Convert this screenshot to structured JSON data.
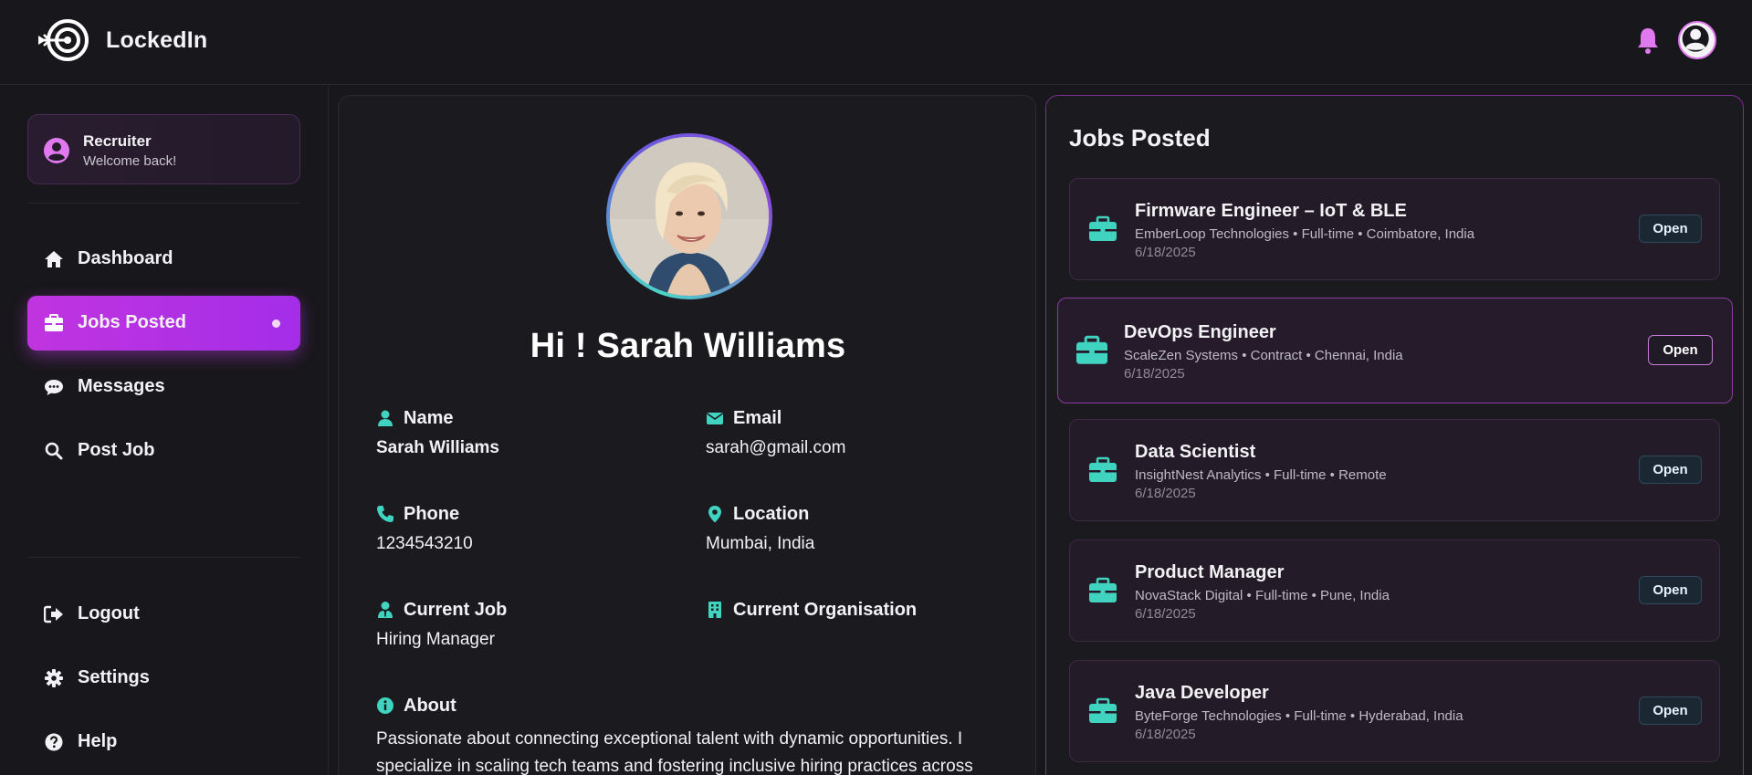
{
  "header": {
    "app_name": "LockedIn",
    "bell_icon": "bell-icon",
    "avatar_icon": "user-circle-icon",
    "accent": "#e079f0"
  },
  "sidebar": {
    "role": {
      "title": "Recruiter",
      "subtitle": "Welcome back!"
    },
    "nav": [
      {
        "label": "Dashboard",
        "icon": "home-icon",
        "active": false
      },
      {
        "label": "Jobs Posted",
        "icon": "briefcase-icon",
        "active": true
      },
      {
        "label": "Messages",
        "icon": "chat-icon",
        "active": false
      },
      {
        "label": "Post Job",
        "icon": "search-icon",
        "active": false
      }
    ],
    "bottom": [
      {
        "label": "Logout",
        "icon": "logout-icon"
      },
      {
        "label": "Settings",
        "icon": "gear-icon"
      },
      {
        "label": "Help",
        "icon": "help-icon"
      }
    ],
    "active_color": "#c134e0"
  },
  "profile": {
    "greeting": "Hi ! Sarah Williams",
    "fields": {
      "name_label": "Name",
      "name_value": "Sarah Williams",
      "email_label": "Email",
      "email_value": "sarah@gmail.com",
      "phone_label": "Phone",
      "phone_value": "1234543210",
      "location_label": "Location",
      "location_value": "Mumbai, India",
      "job_label": "Current Job",
      "job_value": "Hiring Manager",
      "org_label": "Current Organisation",
      "org_value": "",
      "about_label": "About",
      "about_value": "Passionate about connecting exceptional talent with dynamic opportunities. I specialize in scaling tech teams and fostering inclusive hiring practices across"
    },
    "icon_color": "#3fd3c0"
  },
  "jobs": {
    "title": "Jobs Posted",
    "open_label": "Open",
    "items": [
      {
        "title": "Firmware Engineer – IoT & BLE",
        "meta": "EmberLoop Technologies • Full-time • Coimbatore, India",
        "date": "6/18/2025"
      },
      {
        "title": "DevOps Engineer",
        "meta": "ScaleZen Systems • Contract • Chennai, India",
        "date": "6/18/2025"
      },
      {
        "title": "Data Scientist",
        "meta": "InsightNest Analytics • Full-time • Remote",
        "date": "6/18/2025"
      },
      {
        "title": "Product Manager",
        "meta": "NovaStack Digital • Full-time • Pune, India",
        "date": "6/18/2025"
      },
      {
        "title": "Java Developer",
        "meta": "ByteForge Technologies • Full-time • Hyderabad, India",
        "date": "6/18/2025"
      }
    ]
  }
}
